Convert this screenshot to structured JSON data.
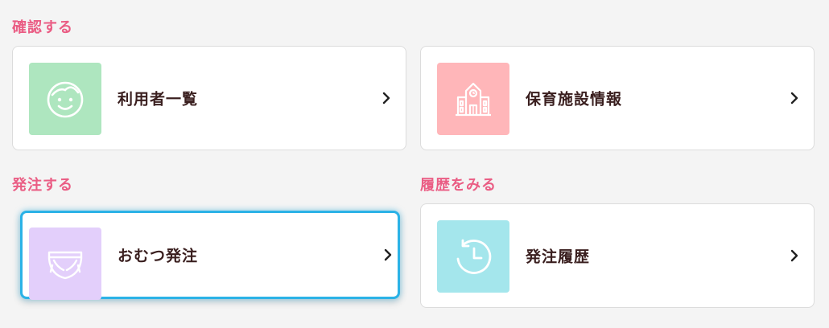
{
  "sections": {
    "confirm": "確認する",
    "order": "発注する",
    "history": "履歴をみる"
  },
  "cards": {
    "users": {
      "label": "利用者一覧",
      "icon": "face-icon",
      "tile_color": "#aee6bf"
    },
    "facility": {
      "label": "保育施設情報",
      "icon": "school-building-icon",
      "tile_color": "#ffb6b9"
    },
    "diaper_order": {
      "label": "おむつ発注",
      "icon": "diaper-icon",
      "tile_color": "#e3cffb"
    },
    "order_history": {
      "label": "発注履歴",
      "icon": "history-clock-icon",
      "tile_color": "#a4e6ec"
    }
  },
  "colors": {
    "section_title": "#ea5d84",
    "label_text": "#3a1f1f",
    "focus_ring": "#2bb2e6",
    "background": "#f4f4f4"
  }
}
